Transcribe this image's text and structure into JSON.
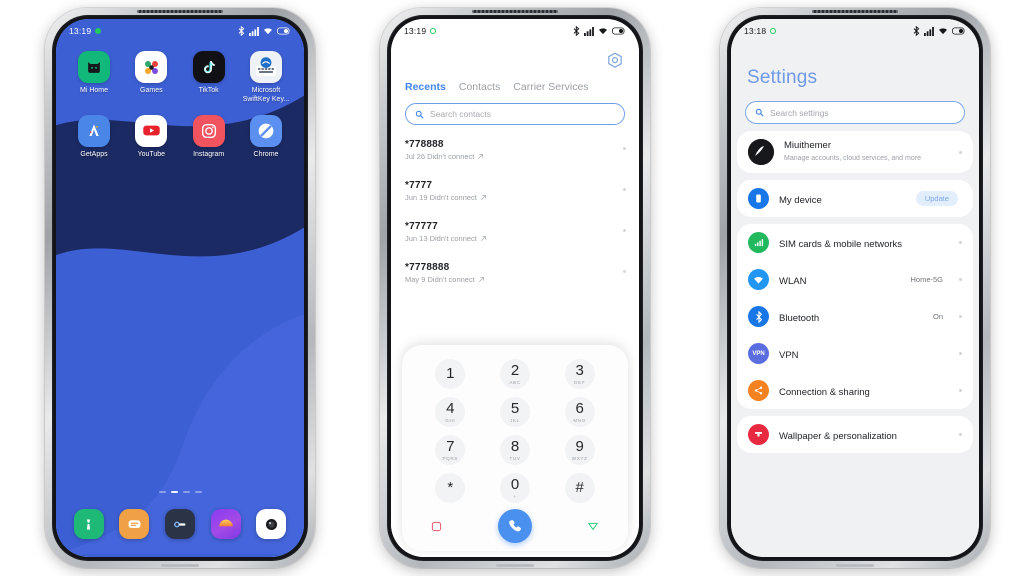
{
  "phones": {
    "home": {
      "status": {
        "time": "13:19",
        "camera_dot": "recording-dot",
        "icons": [
          "bluetooth-icon",
          "signal-icon",
          "wifi-icon",
          "battery-icon"
        ]
      },
      "wallpaper_colors": {
        "base": "#3d5fd4",
        "wave": "#1b2a63"
      },
      "app_rows": [
        [
          {
            "label": "Mi Home",
            "icon": "mi-home-icon",
            "bg": "#12b87a"
          },
          {
            "label": "Games",
            "icon": "games-icon",
            "bg": "#ffffff"
          },
          {
            "label": "TikTok",
            "icon": "tiktok-icon",
            "bg": "#111115"
          },
          {
            "label": "Microsoft SwiftKey Key...",
            "icon": "swiftkey-icon",
            "bg": "#eef2f7"
          }
        ],
        [
          {
            "label": "GetApps",
            "icon": "getapps-icon",
            "bg": "#4a86e8"
          },
          {
            "label": "YouTube",
            "icon": "youtube-icon",
            "bg": "#ffffff"
          },
          {
            "label": "Instagram",
            "icon": "instagram-icon",
            "bg": "#f2545f"
          },
          {
            "label": "Chrome",
            "icon": "chrome-icon",
            "bg": "#5b8ff0"
          }
        ]
      ],
      "page_indicator": {
        "count": 4,
        "active_index": 1
      },
      "dock": [
        {
          "icon": "phone-dock-icon",
          "bg": "#1fb977"
        },
        {
          "icon": "messages-dock-icon",
          "bg": "#f0a045"
        },
        {
          "icon": "settings-dock-icon",
          "bg": "#2b3347"
        },
        {
          "icon": "gallery-dock-icon",
          "bg": "#8a3cf0"
        },
        {
          "icon": "camera-dock-icon",
          "bg": "#ffffff"
        }
      ]
    },
    "dialer": {
      "status": {
        "time": "13:19",
        "camera_dot": "recording-ring",
        "icons": [
          "bluetooth-icon",
          "signal-icon",
          "wifi-icon",
          "battery-icon"
        ]
      },
      "gear": "settings-gear-icon",
      "tabs": [
        {
          "label": "Recents",
          "active": true
        },
        {
          "label": "Contacts",
          "active": false
        },
        {
          "label": "Carrier Services",
          "active": false
        }
      ],
      "search": {
        "placeholder": "Search contacts",
        "icon": "search-icon"
      },
      "calls": [
        {
          "number": "*778888",
          "detail": "Jul 26 Didn't connect",
          "direction": "outgoing-arrow-icon"
        },
        {
          "number": "*7777",
          "detail": "Jun 19 Didn't connect",
          "direction": "outgoing-arrow-icon"
        },
        {
          "number": "*77777",
          "detail": "Jun 13 Didn't connect",
          "direction": "outgoing-arrow-icon"
        },
        {
          "number": "*7778888",
          "detail": "May 9 Didn't connect",
          "direction": "outgoing-arrow-icon"
        }
      ],
      "keypad": [
        {
          "digit": "1",
          "letters": ""
        },
        {
          "digit": "2",
          "letters": "ABC"
        },
        {
          "digit": "3",
          "letters": "DEF"
        },
        {
          "digit": "4",
          "letters": "GHI"
        },
        {
          "digit": "5",
          "letters": "JKL"
        },
        {
          "digit": "6",
          "letters": "MNO"
        },
        {
          "digit": "7",
          "letters": "PQRS"
        },
        {
          "digit": "8",
          "letters": "TUV"
        },
        {
          "digit": "9",
          "letters": "WXYZ"
        },
        {
          "digit": "*",
          "letters": ""
        },
        {
          "digit": "0",
          "letters": "+"
        },
        {
          "digit": "#",
          "letters": ""
        }
      ],
      "nav": {
        "recents_icon": "square-recents-icon",
        "call_icon": "call-handset-icon",
        "back_icon": "triangle-back-icon",
        "call_button_color": "#4a90ef"
      }
    },
    "settings": {
      "status": {
        "time": "13:18",
        "camera_dot": "recording-ring",
        "icons": [
          "bluetooth-icon",
          "signal-icon",
          "wifi-icon",
          "battery-icon"
        ]
      },
      "title": "Settings",
      "search": {
        "placeholder": "Search settings",
        "icon": "search-icon"
      },
      "groups": [
        {
          "rows": [
            {
              "title": "Miuithemer",
              "subtitle": "Manage accounts, cloud services, and more",
              "icon": "account-avatar",
              "icon_bg": "#16181b",
              "value": "",
              "badge": "",
              "chevron": true
            }
          ]
        },
        {
          "rows": [
            {
              "title": "My device",
              "subtitle": "",
              "icon": "device-icon",
              "icon_bg": "#1976e8",
              "value": "",
              "badge": "Update",
              "chevron": false
            }
          ]
        },
        {
          "rows": [
            {
              "title": "SIM cards & mobile networks",
              "subtitle": "",
              "icon": "sim-signal-icon",
              "icon_bg": "#22b95e",
              "value": "",
              "badge": "",
              "chevron": true
            },
            {
              "title": "WLAN",
              "subtitle": "",
              "icon": "wifi-icon",
              "icon_bg": "#2196f3",
              "value": "Home-5G",
              "badge": "",
              "chevron": true
            },
            {
              "title": "Bluetooth",
              "subtitle": "",
              "icon": "bluetooth-icon",
              "icon_bg": "#1976e8",
              "value": "On",
              "badge": "",
              "chevron": true
            },
            {
              "title": "VPN",
              "subtitle": "",
              "icon": "vpn-icon",
              "icon_bg": "#5b6ee0",
              "value": "",
              "badge": "",
              "chevron": true
            },
            {
              "title": "Connection & sharing",
              "subtitle": "",
              "icon": "share-nodes-icon",
              "icon_bg": "#f58220",
              "value": "",
              "badge": "",
              "chevron": true
            }
          ]
        },
        {
          "rows": [
            {
              "title": "Wallpaper & personalization",
              "subtitle": "",
              "icon": "brush-icon",
              "icon_bg": "#e8293f",
              "value": "",
              "badge": "",
              "chevron": true
            }
          ]
        }
      ]
    }
  }
}
